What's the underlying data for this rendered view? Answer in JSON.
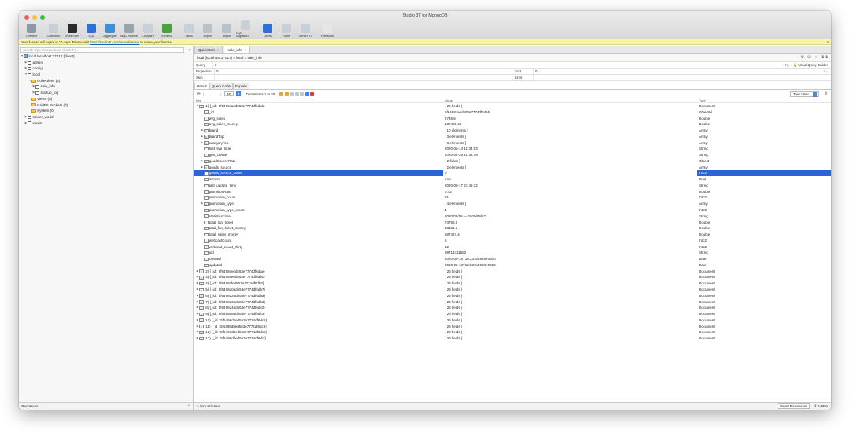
{
  "window": {
    "title": "Studio 3T for MongoDB"
  },
  "toolbar": [
    {
      "label": "Connect",
      "color": "#8a9aa6"
    },
    {
      "label": "Collection",
      "color": "#c8cfd6"
    },
    {
      "label": "IntelliShell",
      "color": "#2b2b2b"
    },
    {
      "label": "SQL",
      "color": "#2f6fd6"
    },
    {
      "label": "Aggregate",
      "color": "#3e8fd6"
    },
    {
      "label": "Map-Reduce",
      "color": "#9aa3ab"
    },
    {
      "label": "Compare",
      "color": "#c8cfd6"
    },
    {
      "label": "Schema",
      "color": "#4aa23a"
    },
    {
      "label": "Tasks",
      "color": "#c8cfd6"
    },
    {
      "label": "Export",
      "color": "#b8c0c8"
    },
    {
      "label": "Import",
      "color": "#b8c0c8"
    },
    {
      "label": "SQL Migration",
      "color": "#c8cfd6"
    },
    {
      "label": "Users",
      "color": "#2f6fd6"
    },
    {
      "label": "Roles",
      "color": "#c8cfd6"
    },
    {
      "label": "Server 3T",
      "color": "#c8cfd6"
    },
    {
      "label": "Feedback",
      "color": "#e6e6e6"
    }
  ],
  "license": {
    "prefix": "Your license will expire in 10 days. Please visit ",
    "link": "https://studio3t.com/renewlicense/",
    "suffix": " to renew your license.",
    "close": "×"
  },
  "sidebar": {
    "search_placeholder": "Search Open Connections (Cmd+F) ...",
    "collapse": "<",
    "tree": [
      {
        "level": 0,
        "arrow": "▼",
        "icon": "server",
        "label": "local localhost:27017 [direct]"
      },
      {
        "level": 1,
        "arrow": "▶",
        "icon": "db",
        "label": "admin"
      },
      {
        "level": 1,
        "arrow": "▶",
        "icon": "db",
        "label": "config"
      },
      {
        "level": 1,
        "arrow": "▼",
        "icon": "db",
        "label": "local"
      },
      {
        "level": 2,
        "arrow": "▼",
        "icon": "folder",
        "label": "Collections (2)"
      },
      {
        "level": 3,
        "arrow": "▶",
        "icon": "coll",
        "label": "sale_info"
      },
      {
        "level": 3,
        "arrow": "▶",
        "icon": "coll",
        "label": "startup_log"
      },
      {
        "level": 2,
        "arrow": "",
        "icon": "folder",
        "label": "Views (0)"
      },
      {
        "level": 2,
        "arrow": "",
        "icon": "folder",
        "label": "GridFS Buckets (0)"
      },
      {
        "level": 2,
        "arrow": "",
        "icon": "folder",
        "label": "System (0)"
      },
      {
        "level": 1,
        "arrow": "▶",
        "icon": "db",
        "label": "spider_world"
      },
      {
        "level": 1,
        "arrow": "▶",
        "icon": "db",
        "label": "wexin"
      }
    ],
    "footer": "Operations",
    "footer_caret": "^"
  },
  "tabs": [
    {
      "label": "Quickstart",
      "active": false
    },
    {
      "label": "sale_info",
      "active": true
    }
  ],
  "breadcrumb": "local (localhost:27017) > local > sale_info",
  "breadcrumb_tools": "⟱ · ⊙ · ☆ · ⧉ ⧉",
  "query": {
    "query_label": "Query",
    "query_value": "0",
    "projection_label": "Projection",
    "projection_value": "0",
    "sort_label": "Sort",
    "sort_value": "0",
    "skip_label": "Skip",
    "skip_value": "",
    "limit_label": "Limit",
    "limit_value": "",
    "tools": "? ▷ · 💡   Visual Query Builder",
    "sort_tools": "↑ ↓"
  },
  "result_tabs": [
    {
      "label": "Result",
      "active": true
    },
    {
      "label": "Query Code",
      "active": false
    },
    {
      "label": "Explain",
      "active": false
    }
  ],
  "nav": {
    "refresh": "⟳",
    "arrows": "|← ← → →|",
    "page_size": "50",
    "documents": "Documents 1 to 50",
    "view": "Tree View",
    "gear": "⚙"
  },
  "columns": {
    "key": "Key",
    "value": "Value",
    "type": "Type"
  },
  "rows": [
    {
      "indent": 0,
      "arrow": "▼",
      "key": "(1) {_id : 5f6498caed553e7774df6dab}",
      "value": "{ 26 fields }",
      "type": "Document"
    },
    {
      "indent": 1,
      "arrow": "",
      "key": "_id",
      "value": "5f6498caed553e7774df6dab",
      "type": "ObjectId"
    },
    {
      "indent": 1,
      "arrow": "",
      "key": "avg_sales",
      "value": "2746.6",
      "type": "Double"
    },
    {
      "indent": 1,
      "arrow": "",
      "key": "avg_sales_money",
      "value": "137485.48",
      "type": "Double"
    },
    {
      "indent": 1,
      "arrow": "▶",
      "key": "brand",
      "value": "[ 10 elements ]",
      "type": "Array"
    },
    {
      "indent": 1,
      "arrow": "▶",
      "key": "brandTop",
      "value": "[ 3 elements ]",
      "type": "Array"
    },
    {
      "indent": 1,
      "arrow": "▶",
      "key": "categoryTop",
      "value": "[ 3 elements ]",
      "type": "Array"
    },
    {
      "indent": 1,
      "arrow": "",
      "key": "first_live_time",
      "value": "2020-05-14 19:34:03",
      "type": "String"
    },
    {
      "indent": 1,
      "arrow": "",
      "key": "gmt_create",
      "value": "2020-02-28 15:32:49",
      "type": "String"
    },
    {
      "indent": 1,
      "arrow": "▶",
      "key": "goodSourceRate",
      "value": "{ 2 fields }",
      "type": "Object"
    },
    {
      "indent": 1,
      "arrow": "▶",
      "key": "goods_source",
      "value": "[ 2 elements ]",
      "type": "Array"
    },
    {
      "indent": 1,
      "arrow": "",
      "key": "goods_source_count",
      "value": "0",
      "type": "Int32",
      "selected": true
    },
    {
      "indent": 1,
      "arrow": "",
      "key": "isExist",
      "value": "true",
      "type": "Bool"
    },
    {
      "indent": 1,
      "arrow": "",
      "key": "last_update_time",
      "value": "2020-09-17 21:45:32",
      "type": "String"
    },
    {
      "indent": 1,
      "arrow": "",
      "key": "promitionRate",
      "value": "0.42",
      "type": "Double"
    },
    {
      "indent": 1,
      "arrow": "",
      "key": "promotion_count",
      "value": "31",
      "type": "Int32"
    },
    {
      "indent": 1,
      "arrow": "▶",
      "key": "promotion_type",
      "value": "[ 4 elements ]",
      "type": "Array"
    },
    {
      "indent": 1,
      "arrow": "",
      "key": "promotion_type_count",
      "value": "4",
      "type": "Int32"
    },
    {
      "indent": 1,
      "arrow": "",
      "key": "statisticsTime",
      "value": "2020/08/19 — 2020/09/17",
      "type": "String"
    },
    {
      "indent": 1,
      "arrow": "",
      "key": "total_fan_ticket",
      "value": "73758.0",
      "type": "Double"
    },
    {
      "indent": 1,
      "arrow": "",
      "key": "total_fan_ticket_money",
      "value": "33191.1",
      "type": "Double"
    },
    {
      "indent": 1,
      "arrow": "",
      "key": "total_sales_money",
      "value": "687427.4",
      "type": "Double"
    },
    {
      "indent": 1,
      "arrow": "",
      "key": "webcastCount",
      "value": "5",
      "type": "Int32"
    },
    {
      "indent": 1,
      "arrow": "",
      "key": "webcast_count_thirty",
      "value": "12",
      "type": "Int32"
    },
    {
      "indent": 1,
      "arrow": "",
      "key": "uid",
      "value": "99714411562",
      "type": "String"
    },
    {
      "indent": 1,
      "arrow": "",
      "key": "created",
      "value": "2020-09-18T19:23:54.928+0800",
      "type": "Date"
    },
    {
      "indent": 1,
      "arrow": "",
      "key": "updated",
      "value": "2020-09-18T19:23:54.928+0800",
      "type": "Date"
    },
    {
      "indent": 0,
      "arrow": "▶",
      "key": "(2) {_id : 5f6498ceed553e7774df6dae}",
      "value": "{ 26 fields }",
      "type": "Document"
    },
    {
      "indent": 0,
      "arrow": "▶",
      "key": "(3) {_id : 5f6498ceed553e7774df6db1}",
      "value": "{ 26 fields }",
      "type": "Document"
    },
    {
      "indent": 0,
      "arrow": "▶",
      "key": "(4) {_id : 5f6498cfed553e7774df6db4}",
      "value": "{ 26 fields }",
      "type": "Document"
    },
    {
      "indent": 0,
      "arrow": "▶",
      "key": "(5) {_id : 5f6498d0ed553e7774df6db7}",
      "value": "{ 26 fields }",
      "type": "Document"
    },
    {
      "indent": 0,
      "arrow": "▶",
      "key": "(6) {_id : 5f6498d2ed553e7774df6dba}",
      "value": "{ 26 fields }",
      "type": "Document"
    },
    {
      "indent": 0,
      "arrow": "▶",
      "key": "(7) {_id : 5f6498d3ed553e7774df6dbd}",
      "value": "{ 26 fields }",
      "type": "Document"
    },
    {
      "indent": 0,
      "arrow": "▶",
      "key": "(8) {_id : 5f6498d4ed553e7774df6dc0}",
      "value": "{ 26 fields }",
      "type": "Document"
    },
    {
      "indent": 0,
      "arrow": "▶",
      "key": "(9) {_id : 5f6498d6ed553e7774df6dc3}",
      "value": "{ 26 fields }",
      "type": "Document"
    },
    {
      "indent": 0,
      "arrow": "▶",
      "key": "(10) {_id : 5f6498d7ed553e7774df6dc6}",
      "value": "{ 26 fields }",
      "type": "Document"
    },
    {
      "indent": 0,
      "arrow": "▶",
      "key": "(11) {_id : 5f6498d8ed553e7774df6dc9}",
      "value": "{ 26 fields }",
      "type": "Document"
    },
    {
      "indent": 0,
      "arrow": "▶",
      "key": "(12) {_id : 5f6498d9ed553e7774df6dcc}",
      "value": "{ 26 fields }",
      "type": "Document"
    },
    {
      "indent": 0,
      "arrow": "▶",
      "key": "(13) {_id : 5f6498dbed553e7774df6dcf}",
      "value": "{ 26 fields }",
      "type": "Document"
    }
  ],
  "status": {
    "left": "1 item selected",
    "count_btn": "Count Documents",
    "time": "⏱ 0.008s"
  }
}
